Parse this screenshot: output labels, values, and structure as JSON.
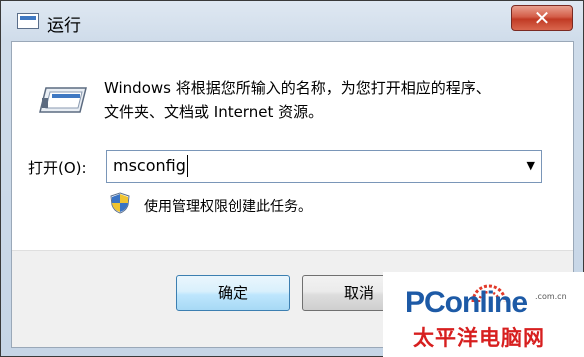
{
  "window": {
    "title": "运行",
    "close_label": "✕"
  },
  "description": {
    "line1": "Windows 将根据您所输入的名称，为您打开相应的程序、",
    "line2": "文件夹、文档或 Internet 资源。"
  },
  "open_field": {
    "label": "打开(O):",
    "value": "msconfig",
    "dropdown_arrow": "▼"
  },
  "admin_note": "使用管理权限创建此任务。",
  "buttons": {
    "ok": "确定",
    "cancel": "取消"
  },
  "watermark": {
    "brand": "PConline",
    "domain": ".com.cn",
    "tagline": "太平洋电脑网"
  },
  "icons": {
    "title": "run-window-icon",
    "run": "run-program-icon",
    "shield": "uac-shield-icon"
  },
  "colors": {
    "close_button": "#c94b35",
    "ok_button_border": "#3c7fb1",
    "brand_blue": "#1d5aa6",
    "brand_red": "#d71f1f"
  }
}
